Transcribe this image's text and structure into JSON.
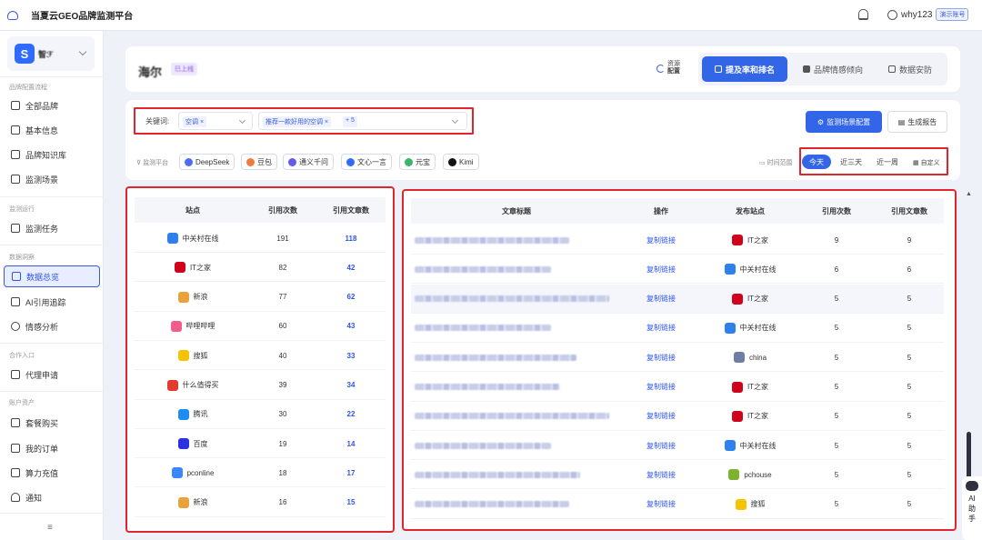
{
  "app": {
    "title": "当夏云GEO品牌监测平台"
  },
  "user": {
    "name": "why123",
    "badge": "演示账号"
  },
  "sidebar": {
    "brand": {
      "logo_letter": "S",
      "name": "智ℱ"
    },
    "groups": [
      {
        "label": "品牌配置流程",
        "items": [
          "全部品牌",
          "基本信息",
          "品牌知识库",
          "监测场景"
        ]
      },
      {
        "label": "监测运行",
        "items": [
          "监测任务"
        ]
      },
      {
        "label": "数据洞察",
        "items": [
          "数据总览",
          "AI引用追踪",
          "情感分析"
        ]
      },
      {
        "label": "合作入口",
        "items": [
          "代理申请"
        ]
      },
      {
        "label": "账户资产",
        "items": [
          "套餐购买",
          "我的订单",
          "算力充值",
          "通知"
        ]
      }
    ],
    "collapse_icon": "≡"
  },
  "brand_header": {
    "name": "海尔",
    "tag": "已上线",
    "resource_line1": "资源",
    "resource_line2": "配置",
    "tabs": [
      "提及率和排名",
      "品牌情感倾向",
      "数据安防"
    ]
  },
  "filters": {
    "keyword_label": "关键词:",
    "keyword_chip": "空调",
    "scene_chip": "推荐一款好用的空调",
    "scene_more": "+ 5",
    "config_button": "监测场景配置",
    "report_button": "生成报告",
    "platform_label": "监测平台",
    "platforms": [
      {
        "name": "DeepSeek",
        "color": "#4d6bfe"
      },
      {
        "name": "豆包",
        "color": "#f07b3f"
      },
      {
        "name": "通义千问",
        "color": "#615ced"
      },
      {
        "name": "文心一言",
        "color": "#2f6bff"
      },
      {
        "name": "元宝",
        "color": "#3bb56c"
      },
      {
        "name": "Kimi",
        "color": "#111111"
      }
    ],
    "time_label": "时间范围",
    "time_options": [
      "今天",
      "近三天",
      "近一周"
    ],
    "custom": "自定义"
  },
  "sites_table": {
    "headers": [
      "站点",
      "引用次数",
      "引用文章数"
    ],
    "rows": [
      {
        "site": "中关村在线",
        "count": "191",
        "articles": "118",
        "color": "#2f80ed"
      },
      {
        "site": "IT之家",
        "count": "82",
        "articles": "42",
        "color": "#d0021b"
      },
      {
        "site": "新浪",
        "count": "77",
        "articles": "62",
        "color": "#e8a33d"
      },
      {
        "site": "哔哩哔哩",
        "count": "60",
        "articles": "43",
        "color": "#f25d8e"
      },
      {
        "site": "搜狐",
        "count": "40",
        "articles": "33",
        "color": "#f5c400"
      },
      {
        "site": "什么值得买",
        "count": "39",
        "articles": "34",
        "color": "#e23b2e"
      },
      {
        "site": "腾讯",
        "count": "30",
        "articles": "22",
        "color": "#1f8df0"
      },
      {
        "site": "百度",
        "count": "19",
        "articles": "14",
        "color": "#2932e1"
      },
      {
        "site": "pconline",
        "count": "18",
        "articles": "17",
        "color": "#3a86ff"
      },
      {
        "site": "新浪",
        "count": "16",
        "articles": "15",
        "color": "#e8a33d"
      }
    ]
  },
  "articles_table": {
    "headers": [
      "文章标题",
      "操作",
      "发布站点",
      "引用次数",
      "引用文章数"
    ],
    "rows": [
      {
        "action": "复制链接",
        "site": "IT之家",
        "count": "9",
        "articles": "9",
        "color": "#d0021b"
      },
      {
        "action": "复制链接",
        "site": "中关村在线",
        "count": "6",
        "articles": "6",
        "color": "#2f80ed"
      },
      {
        "action": "复制链接",
        "site": "IT之家",
        "count": "5",
        "articles": "5",
        "color": "#d0021b"
      },
      {
        "action": "复制链接",
        "site": "中关村在线",
        "count": "5",
        "articles": "5",
        "color": "#2f80ed"
      },
      {
        "action": "复制链接",
        "site": "china",
        "count": "5",
        "articles": "5",
        "color": "#6f7ea5"
      },
      {
        "action": "复制链接",
        "site": "IT之家",
        "count": "5",
        "articles": "5",
        "color": "#d0021b"
      },
      {
        "action": "复制链接",
        "site": "IT之家",
        "count": "5",
        "articles": "5",
        "color": "#d0021b"
      },
      {
        "action": "复制链接",
        "site": "中关村在线",
        "count": "5",
        "articles": "5",
        "color": "#2f80ed"
      },
      {
        "action": "复制链接",
        "site": "pchouse",
        "count": "5",
        "articles": "5",
        "color": "#7bb32e"
      },
      {
        "action": "复制链接",
        "site": "搜狐",
        "count": "5",
        "articles": "5",
        "color": "#f5c400"
      }
    ]
  },
  "ai_assistant": {
    "label1": "AI",
    "label2": "助",
    "label3": "手"
  }
}
